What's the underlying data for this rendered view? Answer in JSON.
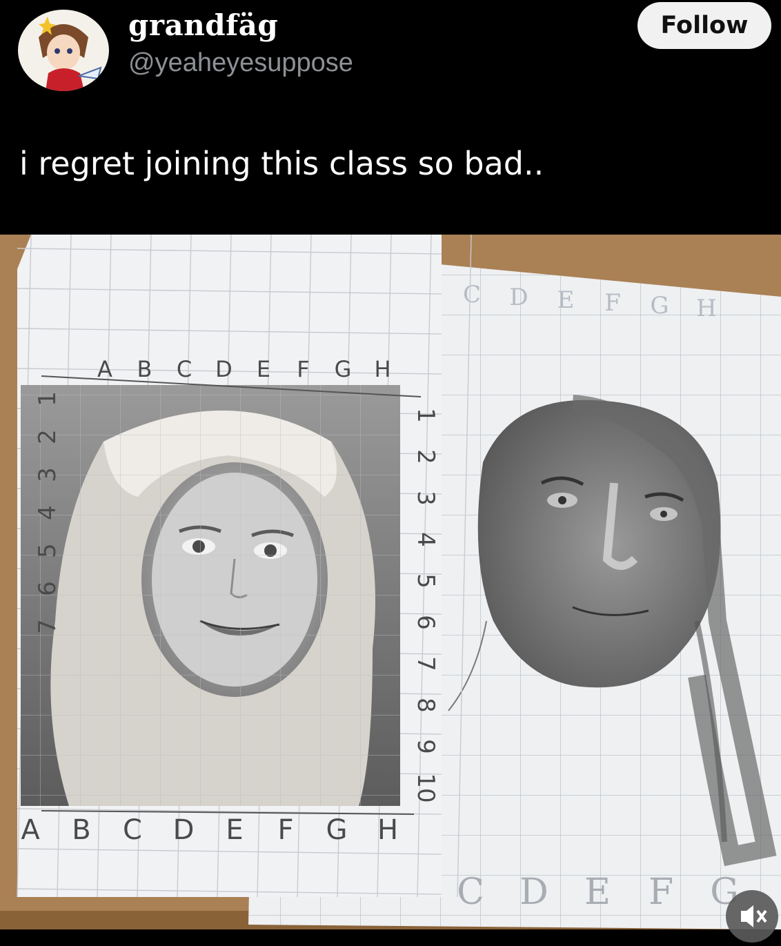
{
  "post": {
    "display_name": "grandfäg",
    "handle": "@yeaheyesuppose",
    "follow_label": "Follow",
    "text": "i regret joining this class so bad.."
  },
  "reference_grid": {
    "columns": [
      "A",
      "B",
      "C",
      "D",
      "E",
      "F",
      "G",
      "H"
    ],
    "rows": [
      "1",
      "2",
      "3",
      "4",
      "5",
      "6",
      "7",
      "8",
      "9",
      "10"
    ]
  },
  "drawing_grid": {
    "top_columns": [
      "A",
      "B",
      "C",
      "D",
      "E",
      "F",
      "G",
      "H"
    ],
    "bottom_columns": [
      "C",
      "D",
      "E",
      "F",
      "G"
    ]
  },
  "icons": {
    "avatar": "anime-avatar-icon",
    "mute": "muted-speaker-icon"
  },
  "colors": {
    "background": "#000000",
    "handle": "#8d9196",
    "follow_bg": "#f1f1f1"
  }
}
